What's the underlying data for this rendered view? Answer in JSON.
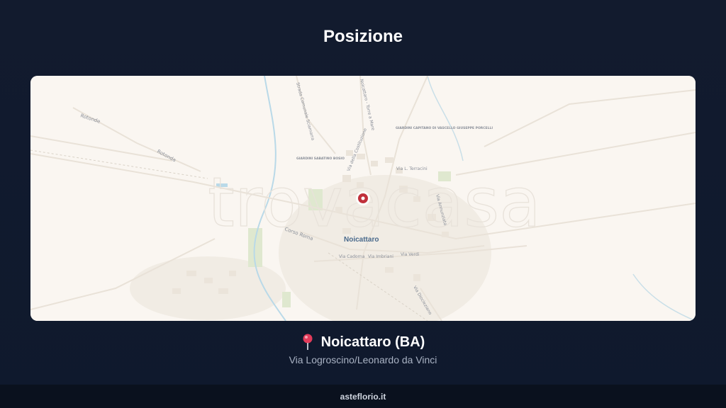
{
  "header": {
    "title": "Posizione"
  },
  "map": {
    "watermark": "trovacasa",
    "city_label": "Noicattaro",
    "labels": [
      "Rotonde",
      "Rotonda",
      "Strada Comunale Sciamarra",
      "Noicattaro - Torre a Mare",
      "Via della Costituzione",
      "GIARDINI CAPITANO DI VASCELLO GIUSEPPE PORCELLI",
      "GIARDINI SABATINO BOSIO",
      "Via L. Terracini",
      "Via Annunziata",
      "Corso Roma",
      "Via Cadorna",
      "Via Imbriani",
      "Via Verdi",
      "Via Diocleziano"
    ],
    "colors": {
      "background": "#faf6f1",
      "marker": "#c0303b",
      "park": "#dfe8cf",
      "water": "#b9d9e8"
    }
  },
  "location": {
    "pin_icon": "round-pushpin-icon",
    "name": "Noicattaro (BA)",
    "address": "Via Logroscino/Leonardo da Vinci"
  },
  "footer": {
    "site": "asteflorio.it"
  }
}
